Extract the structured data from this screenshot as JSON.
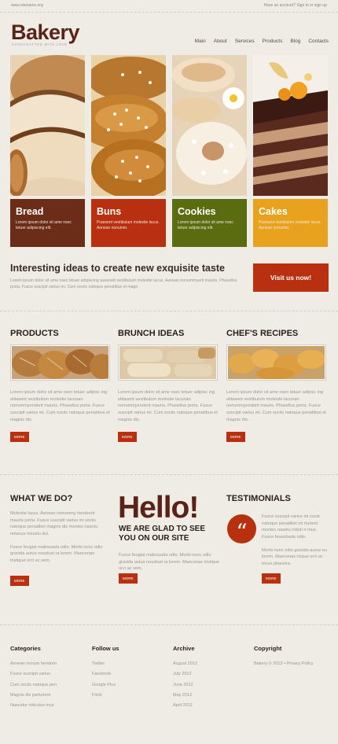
{
  "topbar": {
    "site": "www.sitename.org",
    "account": "Have an account? Sign in or sign up"
  },
  "brand": {
    "name": "Bakery",
    "tagline": "HANDCRAFTED WITH LOVE"
  },
  "nav": [
    "Main",
    "About",
    "Services",
    "Products",
    "Blog",
    "Contacts"
  ],
  "tiles": [
    {
      "title": "Bread",
      "text": "Lorem ipsum dolor sit ame nsec tetuer adipiscing elit.",
      "color": "#6b2c18",
      "icon": "bread-photo"
    },
    {
      "title": "Buns",
      "text": "Praesent vestibulum molestie lacus. Aenean nonumm.",
      "color": "#b8300f",
      "icon": "buns-photo"
    },
    {
      "title": "Cookies",
      "text": "Lorem ipsum dolor sit ame nsec tetuer adipiscing elit.",
      "color": "#5b6b10",
      "icon": "cookies-photo"
    },
    {
      "title": "Cakes",
      "text": "Praesent vestibulum molestie lacus. Aenean nonumm.",
      "color": "#e8a21e",
      "icon": "cakes-photo"
    }
  ],
  "promo": {
    "heading": "Interesting ideas to create new exquisite taste",
    "text": "Lorem ipsum dolor sit ame nsec tetuer adipiscing aasesett vestibulum molestie lacus. Aenean nonummyerit mauris. Phasellus porta. Fusce suscipit varius mi. Cum sociis natoque penatibus et magn.",
    "button": "Visit us now!"
  },
  "features": [
    {
      "title": "PRODUCTS",
      "text": "Lorem ipsum dolor sit ame nsec tetuer adipisc ing elitasent vestibulum molestie lacunan nonummyenderit mauris. Phasellus porta. Fusce suscipit varius mi. Cum sociis natoque penatibus et magnis dis.",
      "button": "MORE"
    },
    {
      "title": "BRUNCH IDEAS",
      "text": "Lorem ipsum dolor sit ame nsec tetuer adipisc ing elitasent vestibulum molestie lacunan nonummyenderit mauris. Phasellus porta. Fusce suscipit varius mi. Cum sociis natoque penatibus et magnis dis.",
      "button": "MORE"
    },
    {
      "title": "CHEF'S RECIPES",
      "text": "Lorem ipsum dolor sit ame nsec tetuer adipisc ing elitasent vestibulum molestie lacunan nonummyenderit mauris. Phasellus porta. Fusce suscipit varius mi. Cum sociis natoque penatibus et magnis dis.",
      "button": "MORE"
    }
  ],
  "whatwedo": {
    "title": "WHAT WE DO?",
    "p1": "Molestie lacus. Aenean nonummy hendrerit mauris porta. Fusce suscipit varius mi sociis natoque penatibet magnis dis montes nasetu nelacus mouslu dui.",
    "p2": "Fusce feugiat malesuada odio. Morbi nunc odio gravida autus nouslust ra lorem. Maecenas tristique orci ac sem.",
    "button": "MORE"
  },
  "hello": {
    "big": "Hello!",
    "sub": "WE ARE GLAD TO SEE YOU ON OUR SITE",
    "text": "Fusce feugiat malesuada odio. Morbi nunc odio gravida autus nouslust ra lorem. Maecenas tristique orci ac sem.",
    "button": "MORE"
  },
  "testimonials": {
    "title": "TESTIMONIALS",
    "quote_mark": "“",
    "p1": "Fusce suscipit varius mi socie natoque penatibet mi rturient montes nasetu niduri ri mus. Fusce feuesbada odio.",
    "p2": "Morbi nunc odio gravida aurus eu lorem. Maecenas risque orci ac trices pharetra.",
    "button": "MORE"
  },
  "footer": {
    "categories": {
      "title": "Categories",
      "items": [
        "Aenean nonum hendren",
        "Fusce suscipit varius",
        "Cum sociis natoque pen",
        "Magnis dis parturient",
        "Nascetur ridiculus mus"
      ]
    },
    "follow": {
      "title": "Follow us",
      "items": [
        "Twitter",
        "Facebook",
        "Google Plus",
        "Flickr"
      ]
    },
    "archive": {
      "title": "Archive",
      "items": [
        "August 2012",
        "July 2012",
        "June 2012",
        "May 2012",
        "April 2012"
      ]
    },
    "copyright": {
      "title": "Copyright",
      "text": "Bakery © 2013 • Privacy Policy"
    }
  }
}
